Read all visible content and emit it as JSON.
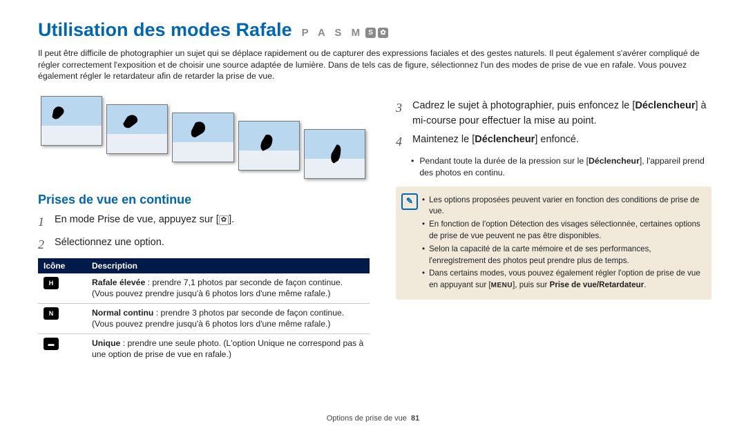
{
  "title": "Utilisation des modes Rafale",
  "mode_letters": "P A S M",
  "intro": "Il peut être difficile de photographier un sujet qui se déplace rapidement ou de capturer des expressions faciales et des gestes naturels. Il peut également s'avérer compliqué de régler correctement l'exposition et de choisir une source adaptée de lumière. Dans de tels cas de figure, sélectionnez l'un des modes de prise de vue en rafale. Vous pouvez également régler le retardateur afin de retarder la prise de vue.",
  "section": "Prises de vue en continue",
  "step1": "En mode Prise de vue, appuyez sur [",
  "step1_end": "].",
  "step2": "Sélectionnez une option.",
  "table": {
    "h1": "Icône",
    "h2": "Description",
    "rows": [
      {
        "icon": "H",
        "bold": "Rafale élevée",
        "rest": " : prendre 7,1 photos par seconde de façon continue. (Vous pouvez prendre jusqu'à 6 photos lors d'une même rafale.)"
      },
      {
        "icon": "N",
        "bold": "Normal continu",
        "rest": " : prendre 3 photos par seconde de façon continue. (Vous pouvez prendre jusqu'à 6 photos lors d'une même rafale.)"
      },
      {
        "icon": "",
        "bold": "Unique",
        "rest": " : prendre une seule photo. (L'option Unique ne correspond pas à une option de prise de vue en rafale.)"
      }
    ]
  },
  "step3_a": "Cadrez le sujet à photographier, puis enfoncez le [",
  "step3_b": "Déclencheur",
  "step3_c": "] à mi-course pour effectuer la mise au point.",
  "step4_a": "Maintenez le [",
  "step4_b": "Déclencheur",
  "step4_c": "] enfoncé.",
  "sub1_a": "Pendant toute la durée de la pression sur le [",
  "sub1_b": "Déclencheur",
  "sub1_c": "], l'appareil prend des photos en continu.",
  "note": {
    "items": [
      "Les options proposées peuvent varier en fonction des conditions de prise de vue.",
      "En fonction de l'option Détection des visages sélectionnée, certaines options de prise de vue peuvent ne pas être disponibles.",
      "Selon la capacité de la carte mémoire et de ses performances, l'enregistrement des photos peut prendre plus de temps.",
      "Dans certains modes, vous pouvez également régler l'option de prise de vue en appuyant sur [MENU], puis sur Prise de vue/Retardateur."
    ],
    "bold_tail": "Prise de vue/Retardateur"
  },
  "footer_a": "Options de prise de vue",
  "footer_b": "81"
}
